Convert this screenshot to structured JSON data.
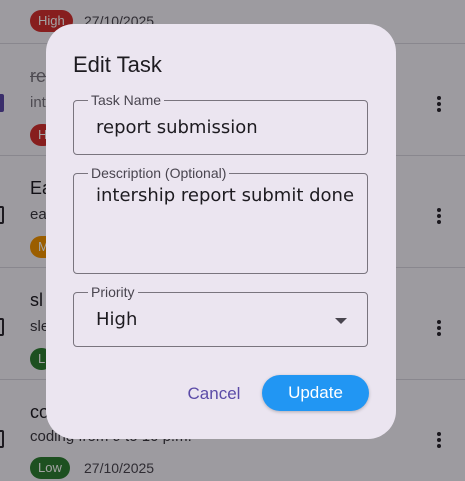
{
  "tasks": [
    {
      "title": "",
      "description": "",
      "priority": "High",
      "priority_color": "#d32f2f",
      "date": "27/10/2025",
      "checked": false
    },
    {
      "title": "re",
      "description": "int",
      "priority": "H",
      "priority_color": "#d32f2f",
      "date": "",
      "checked": true
    },
    {
      "title": "Ea",
      "description": "ea",
      "priority": "M",
      "priority_color": "#f29400",
      "date": "",
      "checked": false
    },
    {
      "title": "sl",
      "description": "sle",
      "priority": "L",
      "priority_color": "#2e7d32",
      "date": "",
      "checked": false
    },
    {
      "title": "co",
      "description": "coding from 9 to 10 p.m.",
      "priority": "Low",
      "priority_color": "#2e7d32",
      "date": "27/10/2025",
      "checked": false
    }
  ],
  "dialog": {
    "title": "Edit Task",
    "task_name_label": "Task Name",
    "task_name_value": "report submission",
    "description_label": "Description (Optional)",
    "description_value": "intership report submit done",
    "priority_label": "Priority",
    "priority_value": "High",
    "cancel_label": "Cancel",
    "update_label": "Update",
    "update_color": "#2196f3",
    "cancel_color": "#5b4ba7"
  }
}
